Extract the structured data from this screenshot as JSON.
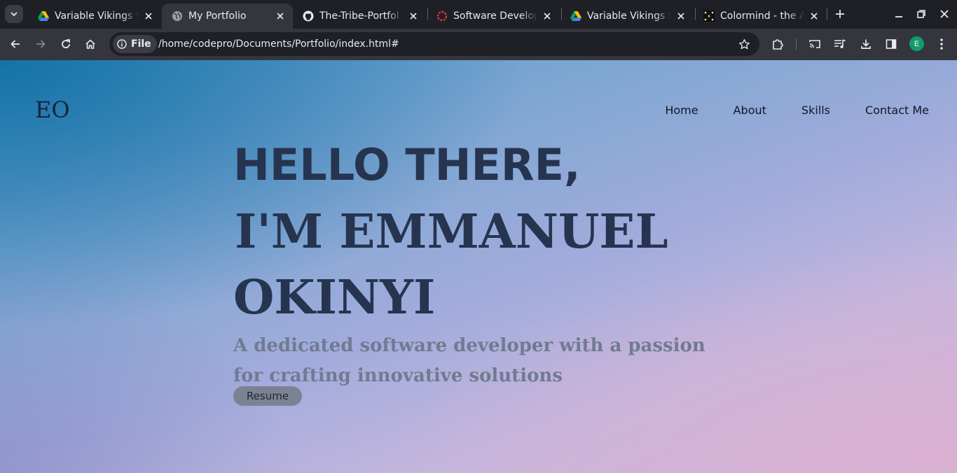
{
  "browser": {
    "tabs": [
      {
        "title": "Variable Vikings S",
        "icon": "google-drive-icon",
        "active": false
      },
      {
        "title": "My Portfolio",
        "icon": "globe-icon",
        "active": true
      },
      {
        "title": "The-Tribe-Portfol",
        "icon": "github-icon",
        "active": false
      },
      {
        "title": "Software Develop",
        "icon": "red-ring-icon",
        "active": false
      },
      {
        "title": "Variable Vikings S",
        "icon": "google-drive-icon",
        "active": false
      },
      {
        "title": "Colormind - the A",
        "icon": "colormind-icon",
        "active": false
      }
    ],
    "address": {
      "scheme_chip": "File",
      "url": "/home/codepro/Documents/Portfolio/index.html#"
    },
    "profile_initial": "E",
    "colors": {
      "frame": "#1f2026",
      "toolbar": "#35363d",
      "profile": "#129b6b"
    }
  },
  "site": {
    "logo": "EO",
    "nav": [
      {
        "label": "Home"
      },
      {
        "label": "About"
      },
      {
        "label": "Skills"
      },
      {
        "label": "Contact Me"
      }
    ],
    "hero": {
      "line1": "HELLO THERE,",
      "line2": "I'M EMMANUEL",
      "line3": "OKINYI",
      "tagline": "A dedicated software developer with a passion for crafting innovative solutions",
      "button": "Resume"
    },
    "colors": {
      "heading": "#263450",
      "tagline": "#727a92",
      "button_bg": "#7c8292"
    }
  }
}
